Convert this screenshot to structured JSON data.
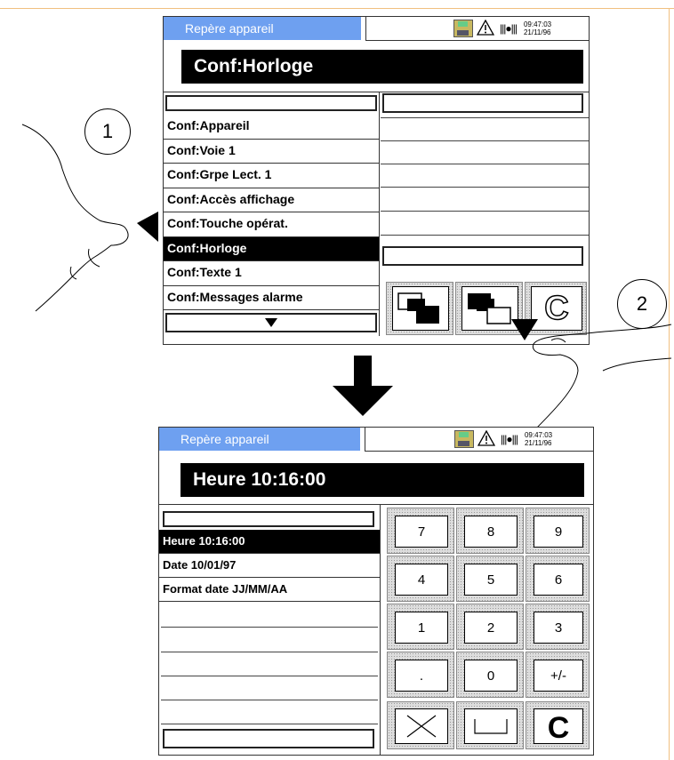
{
  "screen1": {
    "tag": "Repère appareil",
    "clock_time": "09:47:03",
    "clock_date": "21/11/96",
    "title": "Conf:Horloge",
    "menu": [
      {
        "label": "Conf:Appareil",
        "selected": false
      },
      {
        "label": "Conf:Voie  1",
        "selected": false
      },
      {
        "label": "Conf:Grpe  Lect.  1",
        "selected": false
      },
      {
        "label": "Conf:Accès  affichage",
        "selected": false
      },
      {
        "label": "Conf:Touche   opérat.",
        "selected": false
      },
      {
        "label": "Conf:Horloge",
        "selected": true
      },
      {
        "label": "Conf:Texte  1",
        "selected": false
      },
      {
        "label": "Conf:Messages   alarme",
        "selected": false
      }
    ],
    "scroll_down_icon": "triangle-down",
    "buttons": [
      "page-left-icon",
      "page-right-icon",
      "clear-icon"
    ]
  },
  "callouts": {
    "one": "1",
    "two": "2"
  },
  "screen2": {
    "tag": "Repère appareil",
    "clock_time": "09:47:03",
    "clock_date": "21/11/96",
    "title": "Heure 10:16:00",
    "fields": [
      {
        "label": "Heure 10:16:00",
        "selected": true
      },
      {
        "label": "Date 10/01/97",
        "selected": false
      },
      {
        "label": "Format date JJ/MM/AA",
        "selected": false
      }
    ],
    "keypad": [
      [
        "7",
        "8",
        "9"
      ],
      [
        "4",
        "5",
        "6"
      ],
      [
        "1",
        "2",
        "3"
      ],
      [
        ".",
        "0",
        "+/-"
      ]
    ],
    "bottom_keys": [
      "cancel-icon",
      "space-icon",
      "clear-icon"
    ]
  },
  "colors": {
    "tag_bg": "#6ea0f0",
    "frame": "#f0c080"
  }
}
